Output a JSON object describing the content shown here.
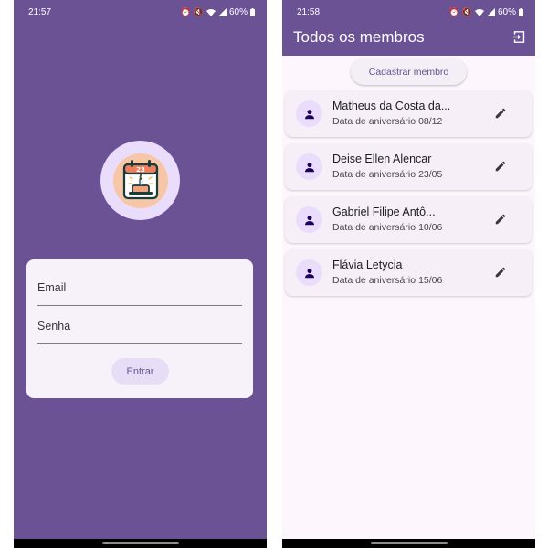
{
  "login_screen": {
    "status": {
      "time": "21:57",
      "battery": "60%"
    },
    "email_label": "Email",
    "password_label": "Senha",
    "login_button": "Entrar",
    "logo_date": "23"
  },
  "members_screen": {
    "status": {
      "time": "21:58",
      "battery": "60%"
    },
    "title": "Todos os membros",
    "register_button": "Cadastrar membro",
    "birthday_label": "Data de aniversário",
    "members": [
      {
        "name": "Matheus da Costa da...",
        "birthday": "08/12"
      },
      {
        "name": "Deise Ellen Alencar",
        "birthday": "23/05"
      },
      {
        "name": "Gabriel Filipe Antô...",
        "birthday": "10/06"
      },
      {
        "name": "Flávia Letycia",
        "birthday": "15/06"
      }
    ]
  },
  "colors": {
    "primary": "#6a5295",
    "card": "#f7f2f9",
    "button": "#e8ddf6",
    "avatar": "#e9ddfb"
  },
  "icons": [
    "alarm-icon",
    "mute-icon",
    "wifi-icon",
    "signal-icon",
    "battery-icon",
    "logout-icon",
    "person-icon",
    "edit-icon",
    "calendar-cake-icon"
  ]
}
